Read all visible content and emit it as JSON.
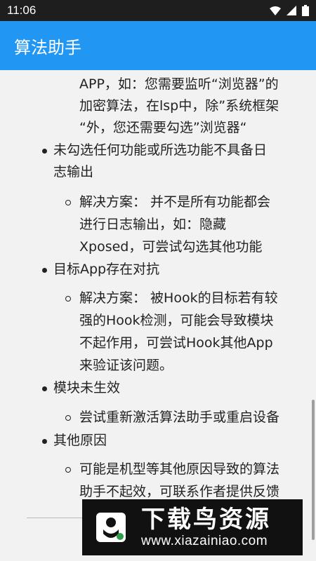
{
  "status_bar": {
    "time": "11:06",
    "icons": [
      "wifi-icon",
      "signal-icon",
      "battery-icon"
    ]
  },
  "app_bar": {
    "title": "算法助手",
    "color": "#2196f3"
  },
  "content": {
    "intro_lines": [
      "APP，如：您需要监听“浏览器”的",
      "加密算法，在lsp中，除”系统框架",
      "“外，您还需要勾选”浏览器“"
    ],
    "items": [
      {
        "title_lines": [
          "未勾选任何功能或所选功能不具备日",
          "志输出"
        ],
        "sub_lines": [
          "解决方案： 并不是所有功能都会",
          "进行日志输出，如：隐藏",
          "Xposed，可尝试勾选其他功能"
        ]
      },
      {
        "title_lines": [
          "目标App存在对抗"
        ],
        "sub_lines": [
          "解决方案： 被Hook的目标若有较",
          "强的Hook检测，可能会导致模块",
          "不起作用，可尝试Hook其他App",
          "来验证该问题。"
        ]
      },
      {
        "title_lines": [
          "模块未生效"
        ],
        "sub_lines": [
          "尝试重新激活算法助手或重启设备"
        ]
      },
      {
        "title_lines": [
          "其他原因"
        ],
        "sub_lines": [
          "可能是机型等其他原因导致的算法",
          "助手不起效，可联系作者提供反馈"
        ]
      }
    ]
  },
  "watermark": {
    "title": "下载鸟资源",
    "url": "www.xiazainiao.com"
  }
}
